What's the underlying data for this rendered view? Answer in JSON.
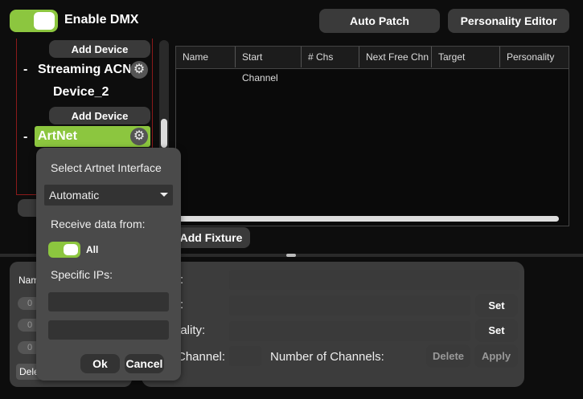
{
  "header": {
    "enable_dmx_label": "Enable DMX",
    "auto_patch_label": "Auto Patch",
    "personality_editor_label": "Personality Editor"
  },
  "tree": {
    "add_device_label_1": "Add Device",
    "streaming_acn_label": "Streaming ACN",
    "device2_label": "Device_2",
    "add_device_label_2": "Add Device",
    "artnet_label": "ArtNet",
    "dash": "-"
  },
  "table": {
    "columns": [
      "Name",
      "Start Channel",
      "# Chs",
      "Next Free Chn",
      "Target",
      "Personality"
    ]
  },
  "add_fixture_label": "Add Fixture",
  "lower_left": {
    "name_label": "Nam",
    "zero": "0",
    "delete_label": "Dele"
  },
  "form": {
    "row1_label": ":",
    "row2_label": ":",
    "personality_label": "nality:",
    "set_label_1": "Set",
    "set_label_2": "Set",
    "channel_label": "Channel:",
    "num_channels_label": "Number of Channels:",
    "delete_label": "Delete",
    "apply_label": "Apply"
  },
  "popup": {
    "title": "Select Artnet Interface",
    "interface_value": "Automatic",
    "receive_label": "Receive data from:",
    "all_label": "All",
    "specific_ips_label": "Specific IPs:",
    "ok_label": "Ok",
    "cancel_label": "Cancel"
  }
}
